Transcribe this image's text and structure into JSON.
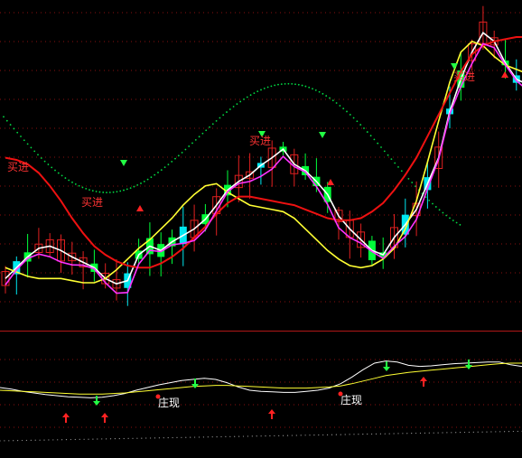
{
  "colors": {
    "background": "#000000",
    "grid": "#8a1010",
    "divider": "#b01818",
    "up_candle": "#e02020",
    "down_candle": "#00ff3a",
    "highlight_up": "#00e8f0",
    "highlight_flag": "#ffff00",
    "ma_white": "#ffffff",
    "ma_yellow": "#ffff33",
    "ma_magenta": "#ff33ff",
    "ma_red": "#ee1111",
    "dots": "#00dd44",
    "signal_up": "#ff2222",
    "signal_down": "#22ff44",
    "label_buy": "#ff3333",
    "label_zhuang": "#ffffff"
  },
  "labels": {
    "buy": "买进",
    "zhuangxian": "庄现"
  },
  "chart_data": [
    {
      "type": "candlestick",
      "series": [
        {
          "name": "",
          "color": "white",
          "values": [
            150,
            160,
            170,
            178,
            180,
            176,
            170,
            165,
            160,
            150,
            145,
            148,
            172,
            180,
            176,
            184,
            190,
            196,
            205,
            218,
            232,
            240,
            246,
            255,
            262,
            270,
            256,
            250,
            240,
            228,
            208,
            196,
            186,
            176,
            172,
            188,
            200,
            214,
            238,
            262,
            305,
            335,
            360,
            378,
            370,
            350,
            335,
            330
          ]
        },
        {
          "name": "",
          "color": "yellow",
          "values": [
            160,
            156,
            152,
            150,
            150,
            150,
            148,
            146,
            146,
            150,
            158,
            168,
            178,
            186,
            196,
            206,
            218,
            228,
            236,
            238,
            230,
            224,
            218,
            216,
            214,
            212,
            206,
            196,
            186,
            176,
            168,
            162,
            160,
            162,
            168,
            178,
            196,
            222,
            258,
            296,
            332,
            360,
            370,
            366,
            356,
            348,
            344,
            340
          ]
        },
        {
          "name": "",
          "color": "red",
          "values": [
            262,
            260,
            256,
            248,
            236,
            222,
            206,
            192,
            180,
            172,
            166,
            162,
            160,
            160,
            164,
            170,
            178,
            188,
            198,
            210,
            220,
            226,
            226,
            224,
            222,
            220,
            218,
            214,
            210,
            206,
            204,
            204,
            206,
            212,
            220,
            232,
            246,
            262,
            282,
            302,
            322,
            342,
            358,
            366,
            370,
            372,
            374,
            374
          ]
        }
      ]
    },
    {
      "type": "line",
      "series": [
        {
          "name": "",
          "color": "white",
          "values": [
            0.55,
            0.52,
            0.48,
            0.45,
            0.42,
            0.4,
            0.38,
            0.37,
            0.36,
            0.37,
            0.4,
            0.44,
            0.5,
            0.55,
            0.6,
            0.64,
            0.68,
            0.7,
            0.72,
            0.7,
            0.64,
            0.56,
            0.5,
            0.48,
            0.47,
            0.46,
            0.46,
            0.48,
            0.5,
            0.54,
            0.62,
            0.74,
            0.88,
            1.0,
            1.04,
            1.02,
            0.96,
            0.94,
            0.95,
            0.97,
            0.99,
            1.0,
            1.01,
            1.02,
            1.02,
            0.97,
            0.94
          ]
        },
        {
          "name": "",
          "color": "yellow",
          "values": [
            0.5,
            0.49,
            0.48,
            0.47,
            0.46,
            0.45,
            0.44,
            0.43,
            0.43,
            0.43,
            0.44,
            0.45,
            0.47,
            0.49,
            0.51,
            0.53,
            0.55,
            0.57,
            0.58,
            0.59,
            0.59,
            0.58,
            0.57,
            0.56,
            0.55,
            0.54,
            0.54,
            0.54,
            0.55,
            0.56,
            0.58,
            0.62,
            0.67,
            0.72,
            0.77,
            0.8,
            0.83,
            0.85,
            0.87,
            0.89,
            0.91,
            0.93,
            0.95,
            0.97,
            0.99,
            1.0,
            1.0
          ]
        }
      ]
    }
  ]
}
